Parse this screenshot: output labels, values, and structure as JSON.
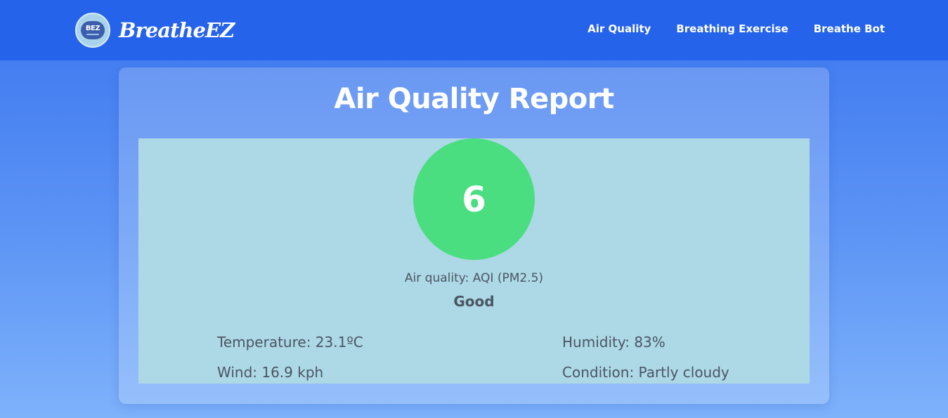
{
  "brand": {
    "logo_mark": "BEZ",
    "name": "BreatheEZ"
  },
  "nav": {
    "items": [
      {
        "label": "Air Quality"
      },
      {
        "label": "Breathing Exercise"
      },
      {
        "label": "Breathe Bot"
      }
    ]
  },
  "report": {
    "title": "Air Quality Report",
    "aqi_value": "6",
    "aqi_label": "Air quality: AQI (PM2.5)",
    "aqi_status": "Good",
    "aqi_color": "#4ade80",
    "panel_color": "#add8e6",
    "temperature": "Temperature: 23.1ºC",
    "humidity": "Humidity: 83%",
    "wind": "Wind: 16.9 kph",
    "condition": "Condition: Partly cloudy"
  },
  "colors": {
    "nav_background": "#2563eb",
    "text_muted": "#4b5563"
  }
}
